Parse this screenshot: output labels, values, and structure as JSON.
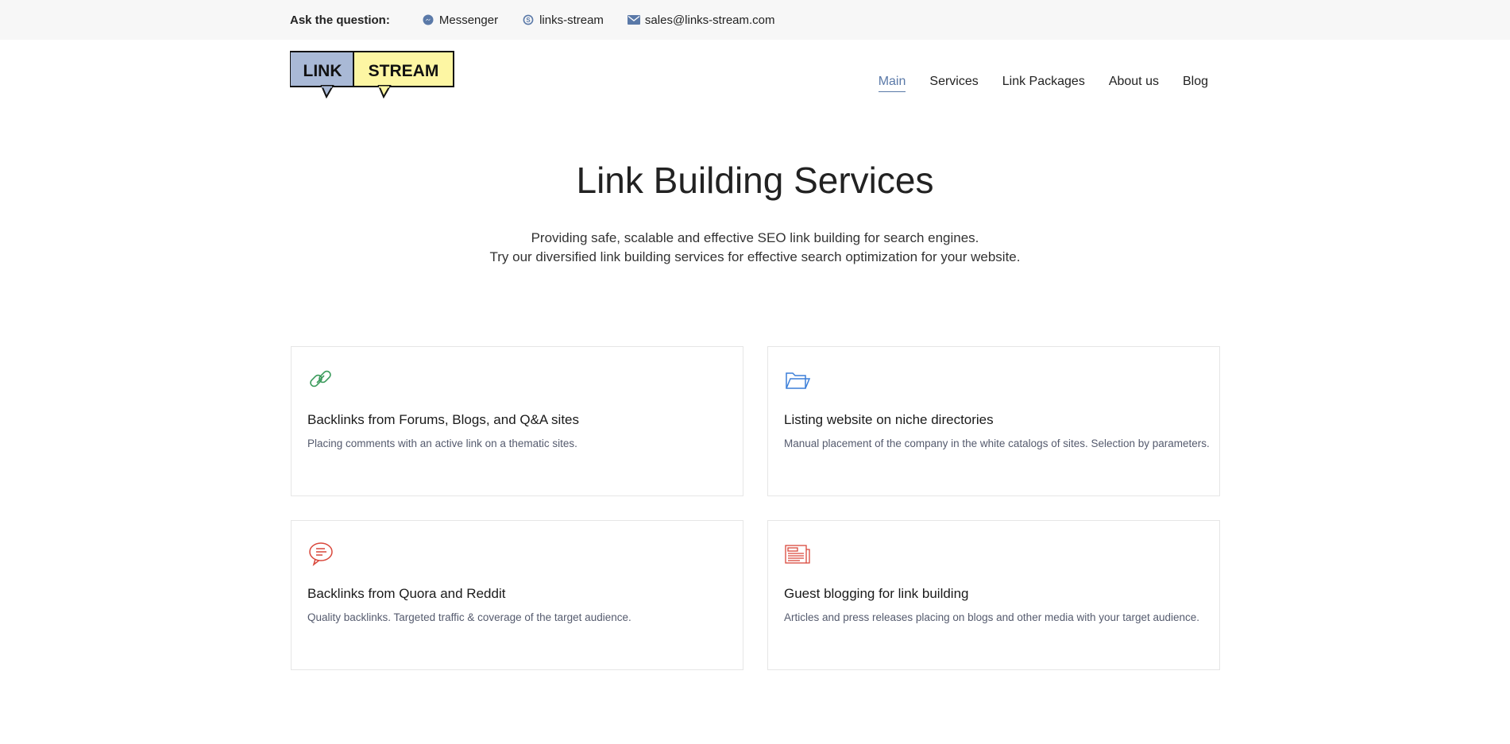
{
  "topbar": {
    "ask_label": "Ask the question:",
    "contacts": [
      {
        "icon": "messenger-icon",
        "label": "Messenger"
      },
      {
        "icon": "skype-icon",
        "label": "links-stream"
      },
      {
        "icon": "envelope-icon",
        "label": "sales@links-stream.com"
      }
    ]
  },
  "logo": {
    "word1": "LINK",
    "word2": "STREAM",
    "color1": "#a9b9d6",
    "color2": "#fdf6a3"
  },
  "nav": {
    "items": [
      {
        "label": "Main",
        "active": true
      },
      {
        "label": "Services",
        "active": false
      },
      {
        "label": "Link Packages",
        "active": false
      },
      {
        "label": "About us",
        "active": false
      },
      {
        "label": "Blog",
        "active": false
      }
    ]
  },
  "hero": {
    "title": "Link Building Services",
    "subtitle_line1": "Providing safe, scalable and effective SEO link building for search engines.",
    "subtitle_line2": "Try our diversified link building services for effective search optimization for your website."
  },
  "services": [
    {
      "icon": "chain-link-icon",
      "icon_color": "#3a9a5b",
      "title": "Backlinks from Forums, Blogs, and Q&A sites",
      "description": "Placing comments with an active link on a thematic sites."
    },
    {
      "icon": "folder-icon",
      "icon_color": "#3b7fd9",
      "title": "Listing website on niche directories",
      "description": "Manual placement of the company in the white catalogs of sites. Selection by parameters."
    },
    {
      "icon": "speech-bubble-icon",
      "icon_color": "#d9473b",
      "title": "Backlinks from Quora and Reddit",
      "description": "Quality backlinks. Targeted traffic & coverage of the target audience."
    },
    {
      "icon": "newspaper-icon",
      "icon_color": "#d9473b",
      "title": "Guest blogging for link building",
      "description": "Articles and press releases placing on blogs and other media with your target audience."
    }
  ]
}
